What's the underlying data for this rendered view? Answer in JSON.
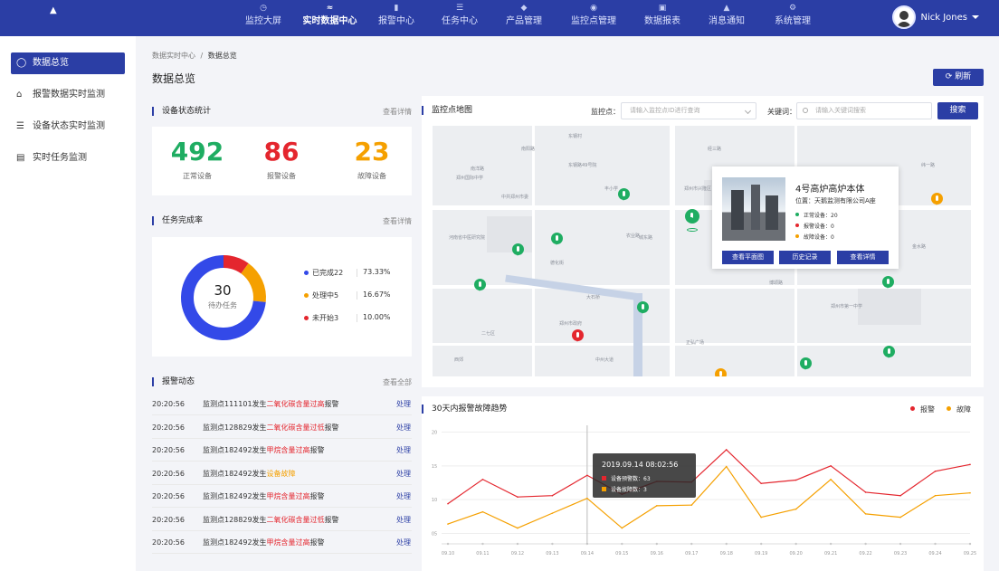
{
  "nav": {
    "items": [
      {
        "label": "监控大屏",
        "icon": "dashboard-icon"
      },
      {
        "label": "实时数据中心",
        "icon": "line-chart-icon"
      },
      {
        "label": "报警中心",
        "icon": "alarm-doc-icon"
      },
      {
        "label": "任务中心",
        "icon": "task-list-icon"
      },
      {
        "label": "产品管理",
        "icon": "layers-icon"
      },
      {
        "label": "监控点管理",
        "icon": "signal-icon"
      },
      {
        "label": "数据报表",
        "icon": "report-icon"
      },
      {
        "label": "消息通知",
        "icon": "bell-icon"
      },
      {
        "label": "系统管理",
        "icon": "gear-icon"
      }
    ],
    "active_index": 1,
    "user_name": "Nick Jones"
  },
  "sidebar": {
    "items": [
      {
        "label": "数据总览",
        "icon": "overview-icon"
      },
      {
        "label": "报警数据实时监测",
        "icon": "alarm-monitor-icon"
      },
      {
        "label": "设备状态实时监测",
        "icon": "device-status-icon"
      },
      {
        "label": "实时任务监测",
        "icon": "task-monitor-icon"
      }
    ]
  },
  "breadcrumb": {
    "parent": "数据实时中心",
    "separator": "/",
    "current": "数据总览"
  },
  "page_title": "数据总览",
  "refresh_label": "刷新",
  "device_stats": {
    "title": "设备状态统计",
    "link": "查看详情",
    "normal": {
      "value": "492",
      "label": "正常设备",
      "color": "#1fad62"
    },
    "alarm": {
      "value": "86",
      "label": "报警设备",
      "color": "#e4262e"
    },
    "fault": {
      "value": "23",
      "label": "故障设备",
      "color": "#f5a000"
    }
  },
  "task_rate": {
    "title": "任务完成率",
    "link": "查看详情",
    "center_value": "30",
    "center_label": "待办任务",
    "segments": [
      {
        "name": "已完成22",
        "pct": "73.33%",
        "value": 73.33,
        "color": "#3349e8"
      },
      {
        "name": "处理中5",
        "pct": "16.67%",
        "value": 16.67,
        "color": "#f5a000"
      },
      {
        "name": "未开始3",
        "pct": "10.00%",
        "value": 10.0,
        "color": "#e4262e"
      }
    ]
  },
  "alarm_feed": {
    "title": "报警动态",
    "link": "查看全部",
    "action": "处理",
    "rows": [
      {
        "time": "20:20:56",
        "pre": "监测点111101发生",
        "hl": "二氧化碳含量过高",
        "post": "报警",
        "color": "red"
      },
      {
        "time": "20:20:56",
        "pre": "监测点128829发生",
        "hl": "二氧化碳含量过低",
        "post": "报警",
        "color": "red"
      },
      {
        "time": "20:20:56",
        "pre": "监测点182492发生",
        "hl": "甲烷含量过高",
        "post": "报警",
        "color": "red"
      },
      {
        "time": "20:20:56",
        "pre": "监测点182492发生",
        "hl": "设备故障",
        "post": "",
        "color": "org"
      },
      {
        "time": "20:20:56",
        "pre": "监测点182492发生",
        "hl": "甲烷含量过高",
        "post": "报警",
        "color": "red"
      },
      {
        "time": "20:20:56",
        "pre": "监测点128829发生",
        "hl": "二氧化碳含量过低",
        "post": "报警",
        "color": "red"
      },
      {
        "time": "20:20:56",
        "pre": "监测点182492发生",
        "hl": "甲烷含量过高",
        "post": "报警",
        "color": "red"
      }
    ]
  },
  "map": {
    "title": "监控点地图",
    "point_label": "监控点：",
    "point_placeholder": "请输入监控点ID进行查询",
    "keyword_label": "关键词：",
    "keyword_placeholder": "请输入关键词搜索",
    "search_label": "搜索",
    "labels": [
      "南阳路",
      "东钢村",
      "南洋路",
      "郑州国际中学",
      "中共郑州市委",
      "东钢路49号院",
      "丰小学",
      "郑州市兴隆区",
      "河南省中医研究院",
      "德化街",
      "大石桥",
      "二七区",
      "西郊",
      "中州大道",
      "经三路",
      "农业路",
      "郑州市政府",
      "城东路",
      "纬一路",
      "金水路",
      "博颂路",
      "郑州市第一中学",
      "正弘广场"
    ],
    "popup": {
      "title": "4号高炉高炉本体",
      "location": "位置：天鹅监测有限公司A座",
      "rows": [
        {
          "label": "正常设备：20",
          "color": "#1fad62"
        },
        {
          "label": "报警设备：0",
          "color": "#e4262e"
        },
        {
          "label": "故障设备：0",
          "color": "#f5a000"
        }
      ],
      "buttons": [
        "查看平面图",
        "历史记录",
        "查看详情"
      ]
    }
  },
  "trend": {
    "title": "30天内报警故障趋势",
    "legend": [
      {
        "name": "报警",
        "color": "#e4262e"
      },
      {
        "name": "故障",
        "color": "#f5a000"
      }
    ],
    "tooltip": {
      "time": "2019.09.14  08:02:56",
      "rows": [
        {
          "label": "设备预警数：63",
          "color": "#e4262e"
        },
        {
          "label": "设备故障数：3",
          "color": "#f5a000"
        }
      ]
    }
  },
  "chart_data": {
    "type": "line",
    "categories": [
      "09.10",
      "09.11",
      "09.12",
      "09.13",
      "09.14",
      "09.15",
      "09.16",
      "09.17",
      "09.18",
      "09.19",
      "09.20",
      "09.21",
      "09.22",
      "09.23",
      "09.24",
      "09.25"
    ],
    "yticks": [
      "20",
      "15",
      "10",
      "05"
    ],
    "ylim": [
      4,
      21
    ],
    "series": [
      {
        "name": "报警",
        "color": "#e4262e",
        "values": [
          9.4,
          13.0,
          10.4,
          10.6,
          13.6,
          10.8,
          12.7,
          12.6,
          17.4,
          12.4,
          12.9,
          15.0,
          11.1,
          10.6,
          14.2,
          15.2
        ]
      },
      {
        "name": "故障",
        "color": "#f5a000",
        "values": [
          6.4,
          8.2,
          5.8,
          8.0,
          10.2,
          5.8,
          9.1,
          9.2,
          14.9,
          7.4,
          8.6,
          13.0,
          7.9,
          7.4,
          10.6,
          11.0
        ]
      }
    ],
    "highlight_index": 4,
    "grid": true,
    "legend_position": "top-right"
  }
}
